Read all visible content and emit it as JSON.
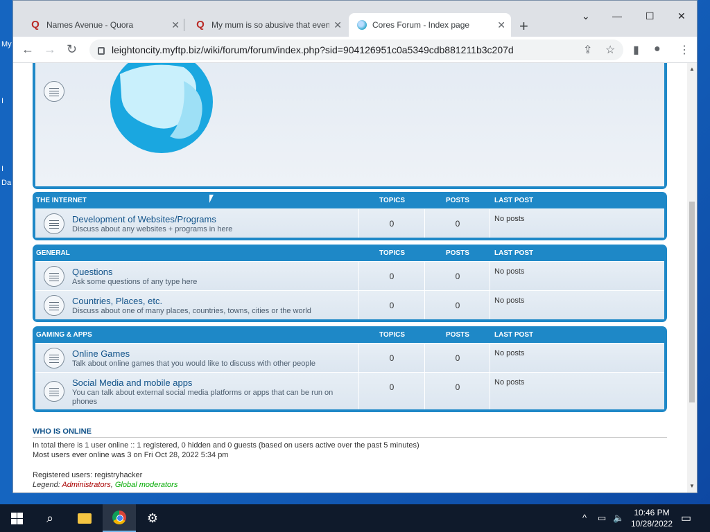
{
  "desktop": {
    "labels": [
      "My",
      "I",
      "I",
      "Da"
    ]
  },
  "tabs": [
    {
      "title": "Names Avenue - Quora",
      "icon": "quora-icon"
    },
    {
      "title": "My mum is so abusive that even",
      "icon": "quora-icon"
    },
    {
      "title": "Cores Forum - Index page",
      "icon": "globe-icon"
    }
  ],
  "browser": {
    "url": "leightoncity.myftp.biz/wiki/forum/forum/index.php?sid=904126951c0a5349cdb881211b3c207d"
  },
  "forum": {
    "columns": {
      "topics": "TOPICS",
      "posts": "POSTS",
      "last_post": "LAST POST"
    },
    "categories": [
      {
        "name": "THE INTERNET",
        "forums": [
          {
            "title": "Development of Websites/Programs",
            "desc": "Discuss about any websites + programs in here",
            "topics": "0",
            "posts": "0",
            "last": "No posts"
          }
        ]
      },
      {
        "name": "GENERAL",
        "forums": [
          {
            "title": "Questions",
            "desc": "Ask some questions of any type here",
            "topics": "0",
            "posts": "0",
            "last": "No posts"
          },
          {
            "title": "Countries, Places, etc.",
            "desc": "Discuss about one of many places, countries, towns, cities or the world",
            "topics": "0",
            "posts": "0",
            "last": "No posts"
          }
        ]
      },
      {
        "name": "GAMING & APPS",
        "forums": [
          {
            "title": "Online Games",
            "desc": "Talk about online games that you would like to discuss with other people",
            "topics": "0",
            "posts": "0",
            "last": "No posts"
          },
          {
            "title": "Social Media and mobile apps",
            "desc": "You can talk about external social media platforms or apps that can be run on phones",
            "topics": "0",
            "posts": "0",
            "last": "No posts"
          }
        ]
      }
    ]
  },
  "who_is_online": {
    "title": "WHO IS ONLINE",
    "line1": "In total there is 1 user online :: 1 registered, 0 hidden and 0 guests (based on users active over the past 5 minutes)",
    "line2": "Most users ever online was 3 on Fri Oct 28, 2022 5:34 pm",
    "registered": "Registered users: registryhacker",
    "legend_label": "Legend:",
    "legend_admin": "Administrators",
    "legend_sep": ",",
    "legend_gmod": "Global moderators"
  },
  "taskbar": {
    "time": "10:46 PM",
    "date": "10/28/2022"
  },
  "colors": {
    "forum_blue": "#1e88c7",
    "link": "#105289",
    "admin": "#aa0000",
    "gmod": "#00aa00"
  }
}
